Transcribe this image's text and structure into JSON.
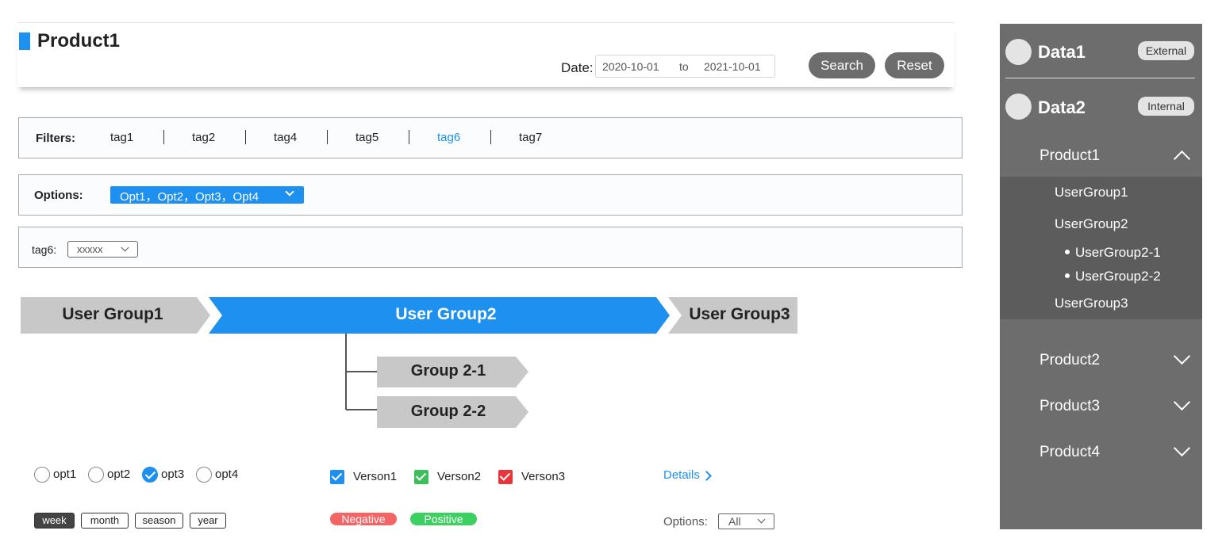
{
  "header": {
    "title": "Product1",
    "date_label": "Date:",
    "date_from": "2020-10-01",
    "date_to_word": "to",
    "date_to": "2021-10-01",
    "search_label": "Search",
    "reset_label": "Reset"
  },
  "filters": {
    "label": "Filters:",
    "tags": [
      "tag1",
      "tag2",
      "tag4",
      "tag5",
      "tag6",
      "tag7"
    ],
    "active_tag": "tag6"
  },
  "options": {
    "label": "Options:",
    "selected": "Opt1，Opt2，Opt3，Opt4"
  },
  "tag6_filter": {
    "label": "tag6:",
    "value": "xxxxx"
  },
  "flow": {
    "steps": [
      "User Group1",
      "User Group2",
      "User Group3"
    ],
    "active_step": "User Group2",
    "children": [
      "Group 2-1",
      "Group 2-2"
    ]
  },
  "radios": {
    "items": [
      "opt1",
      "opt2",
      "opt3",
      "opt4"
    ],
    "selected": "opt3"
  },
  "checkboxes": [
    {
      "label": "Verson1",
      "color": "#1e90f0"
    },
    {
      "label": "Verson2",
      "color": "#3cbf5a"
    },
    {
      "label": "Verson3",
      "color": "#e8353b"
    }
  ],
  "details_label": "Details",
  "periods": {
    "items": [
      "week",
      "month",
      "season",
      "year"
    ],
    "selected": "week"
  },
  "pills": [
    {
      "label": "Negative",
      "color": "#f46464"
    },
    {
      "label": "Positive",
      "color": "#3cd060"
    }
  ],
  "options2": {
    "label": "Options:",
    "value": "All"
  },
  "sidebar": {
    "sources": [
      {
        "name": "Data1",
        "badge": "External"
      },
      {
        "name": "Data2",
        "badge": "Internal"
      }
    ],
    "products": [
      "Product1",
      "Product2",
      "Product3",
      "Product4"
    ],
    "expanded_product": "Product1",
    "user_groups": [
      "UserGroup1",
      "UserGroup2",
      "UserGroup3"
    ],
    "sub_groups": [
      "UserGroup2-1",
      "UserGroup2-2"
    ]
  },
  "colors": {
    "accent": "#1e90f0",
    "sidebar_bg": "#6d6d6d",
    "sidebar_sub_bg": "#5c5c5c",
    "step_grey": "#c8c8c8"
  }
}
